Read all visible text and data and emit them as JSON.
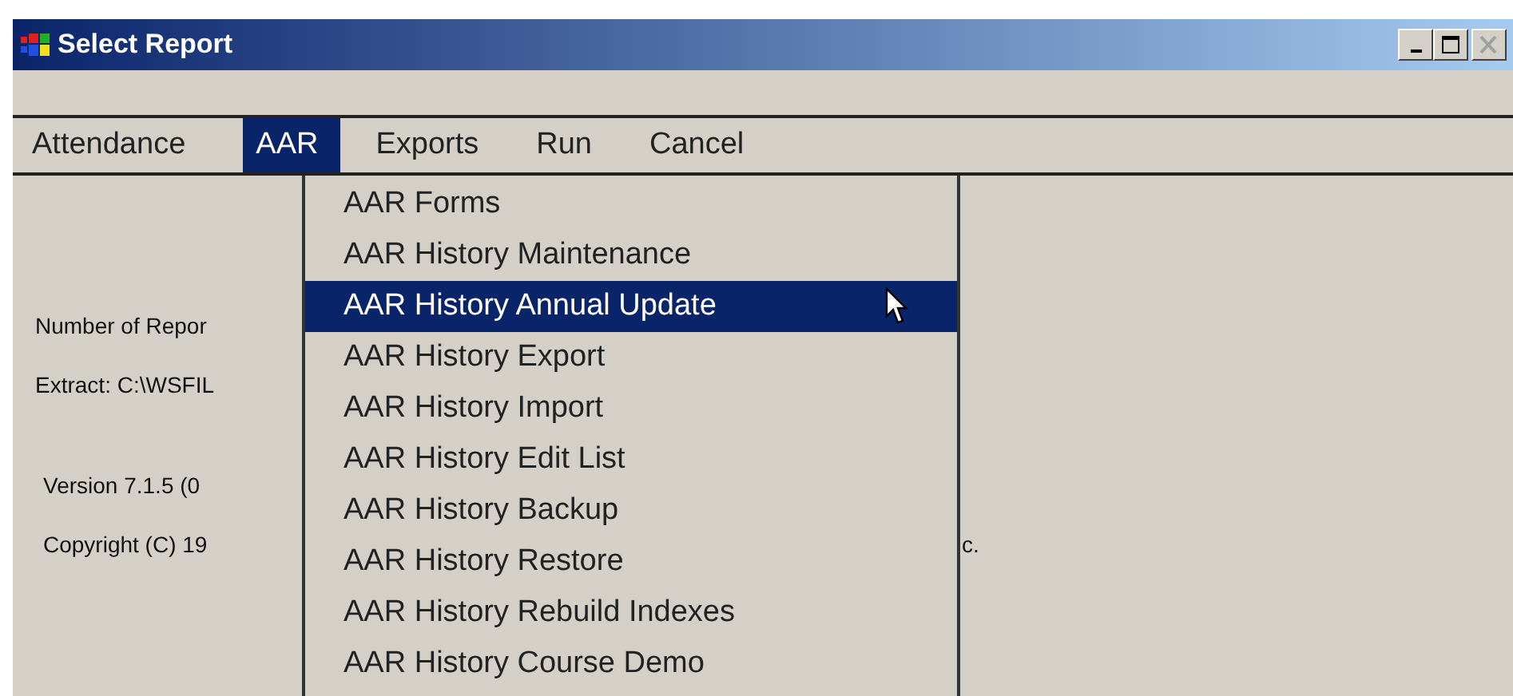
{
  "window": {
    "title": "Select Report",
    "buttons": [
      {
        "kind": "minimize",
        "disabled": false
      },
      {
        "kind": "maximize",
        "disabled": false
      },
      {
        "kind": "close",
        "disabled": true
      }
    ]
  },
  "menu_bar": [
    {
      "label": "Attendance",
      "selected": false
    },
    {
      "label": "AAR",
      "selected": true
    },
    {
      "label": "Exports",
      "selected": false
    },
    {
      "label": "Run",
      "selected": false
    },
    {
      "label": "Cancel",
      "selected": false
    }
  ],
  "content": [
    [
      "Number of Repor",
      "Extract: C:\\WSFIL"
    ],
    [
      "Version 7.1.5  (0",
      "Copyright (C) 19"
    ]
  ],
  "content_tail": "c.",
  "dropdown": [
    {
      "label": "AAR Forms",
      "selected": false
    },
    {
      "label": "AAR History Maintenance",
      "selected": false
    },
    {
      "label": "AAR History Annual Update",
      "selected": true
    },
    {
      "label": "AAR History Export",
      "selected": false
    },
    {
      "label": "AAR History Import",
      "selected": false
    },
    {
      "label": "AAR History Edit List",
      "selected": false
    },
    {
      "label": "AAR History Backup",
      "selected": false
    },
    {
      "label": "AAR History Restore",
      "selected": false
    },
    {
      "label": "AAR History Rebuild Indexes",
      "selected": false
    },
    {
      "label": "AAR History Course Demo",
      "selected": false
    }
  ]
}
